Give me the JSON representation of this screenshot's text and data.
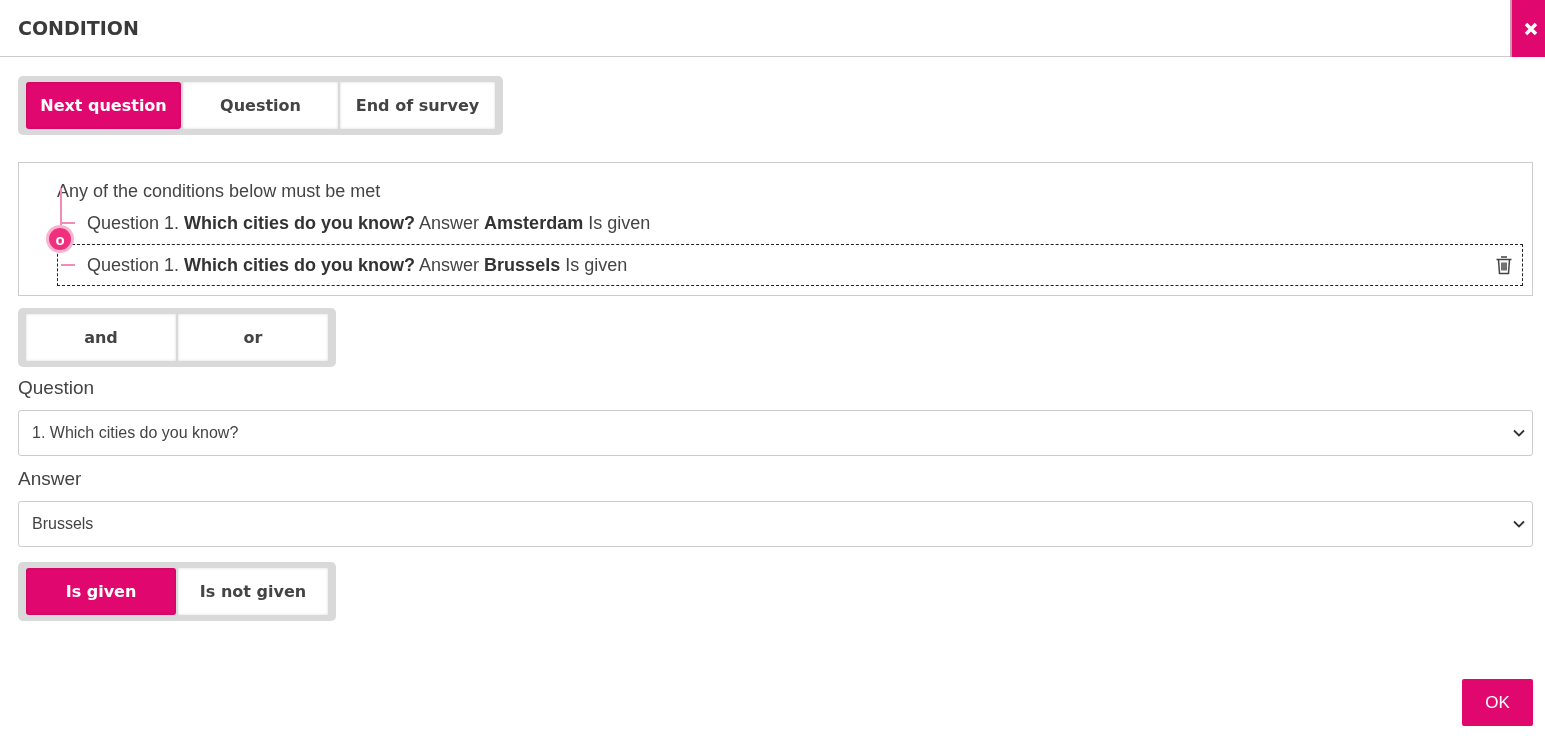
{
  "dialog": {
    "title": "CONDITION"
  },
  "jump": {
    "options": [
      {
        "label": "Next question",
        "selected": true
      },
      {
        "label": "Question",
        "selected": false
      },
      {
        "label": "End of survey",
        "selected": false
      }
    ]
  },
  "conditions": {
    "heading": "Any of the conditions below must be met",
    "operator": "o",
    "items": [
      {
        "text": "Question 1. **Which cities do you know?** Answer **Amsterdam** Is given",
        "selected": false
      },
      {
        "text": "Question 1. **Which cities do you know?** Answer **Brussels** Is given",
        "selected": true
      }
    ]
  },
  "logic": {
    "options": [
      {
        "label": "and",
        "selected": false
      },
      {
        "label": "or",
        "selected": false
      }
    ]
  },
  "fields": [
    {
      "label": "Question",
      "value": "1. Which cities do you know?"
    },
    {
      "label": "Answer",
      "value": "Brussels"
    }
  ],
  "given": {
    "options": [
      {
        "label": "Is given",
        "selected": true
      },
      {
        "label": "Is not given",
        "selected": false
      }
    ]
  },
  "ok_button": "OK"
}
